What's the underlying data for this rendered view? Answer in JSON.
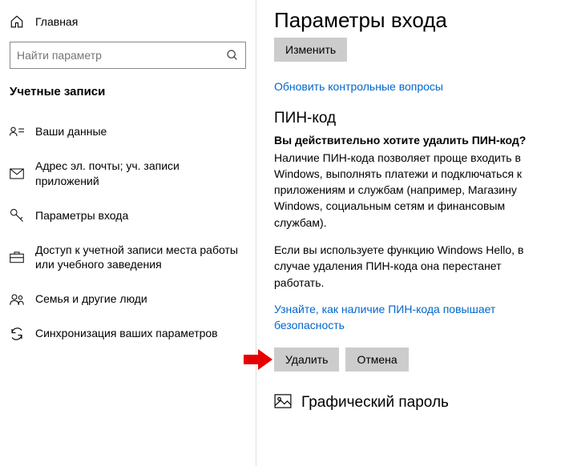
{
  "sidebar": {
    "home": "Главная",
    "search_placeholder": "Найти параметр",
    "section": "Учетные записи",
    "items": [
      {
        "label": "Ваши данные"
      },
      {
        "label": "Адрес эл. почты; уч. записи приложений"
      },
      {
        "label": "Параметры входа"
      },
      {
        "label": "Доступ к учетной записи места работы или учебного заведения"
      },
      {
        "label": "Семья и другие люди"
      },
      {
        "label": "Синхронизация ваших параметров"
      }
    ]
  },
  "content": {
    "title": "Параметры входа",
    "change_btn": "Изменить",
    "update_link": "Обновить контрольные вопросы",
    "pin_heading": "ПИН-код",
    "pin_question": "Вы действительно хотите удалить ПИН-код?",
    "pin_body1": "Наличие ПИН-кода позволяет проще входить в Windows, выполнять платежи и подключаться к приложениям и службам (например, Магазину Windows, социальным сетям и финансовым службам).",
    "pin_body2": "Если вы используете функцию Windows Hello, в случае удаления ПИН-кода она перестанет работать.",
    "learn_link": "Узнайте, как наличие ПИН-кода повышает безопасность",
    "delete_btn": "Удалить",
    "cancel_btn": "Отмена",
    "pic_heading": "Графический пароль"
  }
}
